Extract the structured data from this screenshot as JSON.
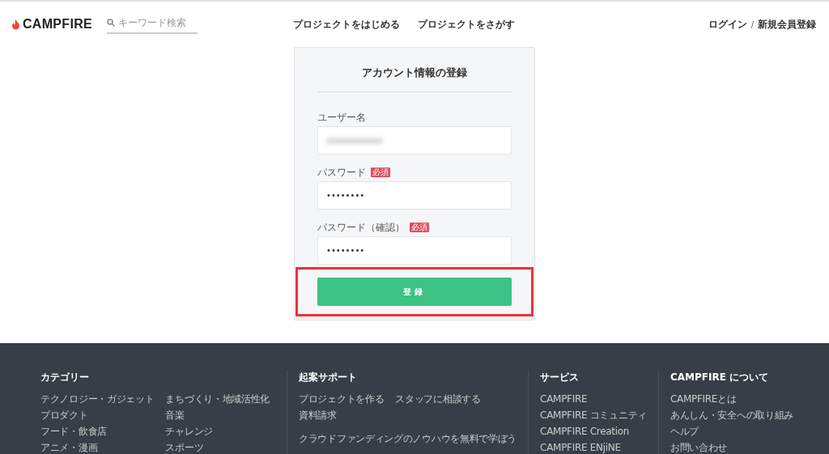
{
  "header": {
    "logo": "CAMPFIRE",
    "search": {
      "placeholder": "キーワード検索"
    },
    "nav": [
      "プロジェクトをはじめる",
      "プロジェクトをさがす"
    ],
    "auth": {
      "login": "ログイン",
      "separator": "/",
      "signup": "新規会員登録"
    }
  },
  "form": {
    "title": "アカウント情報の登録",
    "fields": [
      {
        "label": "ユーザー名",
        "required": false,
        "value_hidden": true
      },
      {
        "label": "パスワード",
        "required": true,
        "badge": "必須",
        "value": "••••••••"
      },
      {
        "label": "パスワード（確認）",
        "required": true,
        "badge": "必須",
        "value": "••••••••"
      }
    ],
    "submit": "登録",
    "submit_highlighted": true
  },
  "footer": {
    "columns": [
      {
        "heading": "カテゴリー",
        "links": [
          "テクノロジー・ガジェット",
          "まちづくり・地域活性化",
          "プロダクト",
          "音楽",
          "フード・飲食店",
          "チャレンジ",
          "アニメ・漫画",
          "スポーツ"
        ]
      },
      {
        "heading": "起案サポート",
        "links": [
          "プロジェクトを作る",
          "スタッフに相談する",
          "資料請求"
        ],
        "extra": "クラウドファンディングのノウハウを無料で学ぼう"
      },
      {
        "heading": "サービス",
        "links": [
          "CAMPFIRE",
          "CAMPFIRE コミュニティ",
          "CAMPFIRE Creation",
          "CAMPFIRE ENjiNE"
        ]
      },
      {
        "heading": "CAMPFIRE について",
        "links": [
          "CAMPFIREとは",
          "あんしん・安全への取り組み",
          "ヘルプ",
          "お問い合わせ"
        ]
      }
    ]
  }
}
